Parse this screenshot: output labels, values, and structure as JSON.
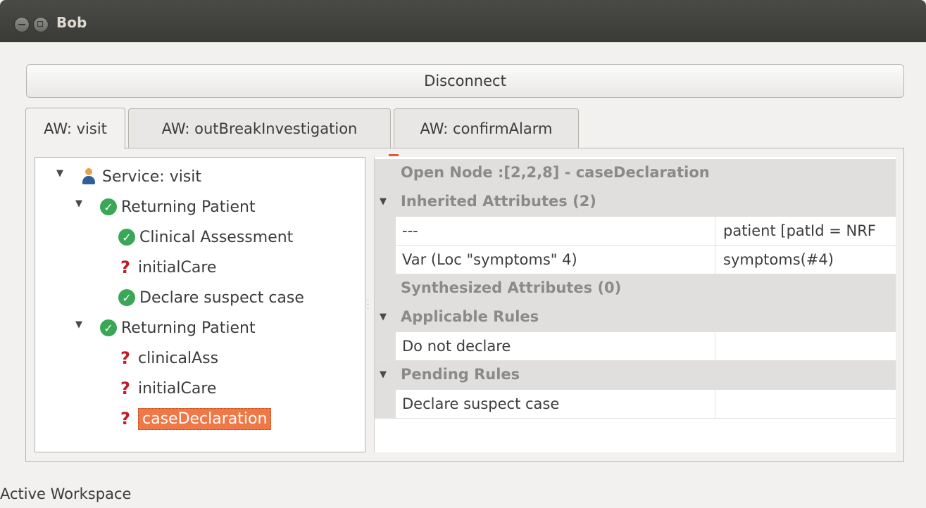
{
  "window": {
    "title": "Bob"
  },
  "toolbar": {
    "disconnect_label": "Disconnect"
  },
  "tabs": [
    {
      "label": "AW: visit",
      "active": true
    },
    {
      "label": "AW: outBreakInvestigation",
      "active": false
    },
    {
      "label": "AW: confirmAlarm",
      "active": false
    }
  ],
  "tree": [
    {
      "label": "Service: visit",
      "icon": "person-icon",
      "level": 0,
      "expanded": true
    },
    {
      "label": "Returning Patient",
      "icon": "check-icon",
      "level": 1,
      "expanded": true
    },
    {
      "label": "Clinical Assessment",
      "icon": "check-icon",
      "level": 2
    },
    {
      "label": "initialCare",
      "icon": "question-icon",
      "level": 2
    },
    {
      "label": "Declare suspect case",
      "icon": "check-icon",
      "level": 2
    },
    {
      "label": "Returning Patient",
      "icon": "check-icon",
      "level": 1,
      "expanded": true
    },
    {
      "label": "clinicalAss",
      "icon": "question-icon",
      "level": 2
    },
    {
      "label": "initialCare",
      "icon": "question-icon",
      "level": 2
    },
    {
      "label": "caseDeclaration",
      "icon": "question-icon",
      "level": 2,
      "selected": true
    }
  ],
  "attributes": {
    "open_node": "Open Node :[2,2,8] - caseDeclaration",
    "inherited_header": "Inherited Attributes (2)",
    "inherited": [
      {
        "key": "---",
        "value": "patient [patId = NRF"
      },
      {
        "key": "Var (Loc \"symptoms\" 4)",
        "value": "symptoms(#4)"
      }
    ],
    "synthesized_header": "Synthesized Attributes (0)",
    "applicable_header": "Applicable Rules",
    "applicable": [
      {
        "key": "Do not declare",
        "value": ""
      }
    ],
    "pending_header": "Pending Rules",
    "pending": [
      {
        "key": "Declare suspect case",
        "value": ""
      }
    ]
  },
  "status": {
    "text": "Active Workspace"
  },
  "colors": {
    "selection": "#f07746",
    "check": "#3aa757",
    "question": "#c01c28",
    "titlebar": "#3c3b37"
  }
}
